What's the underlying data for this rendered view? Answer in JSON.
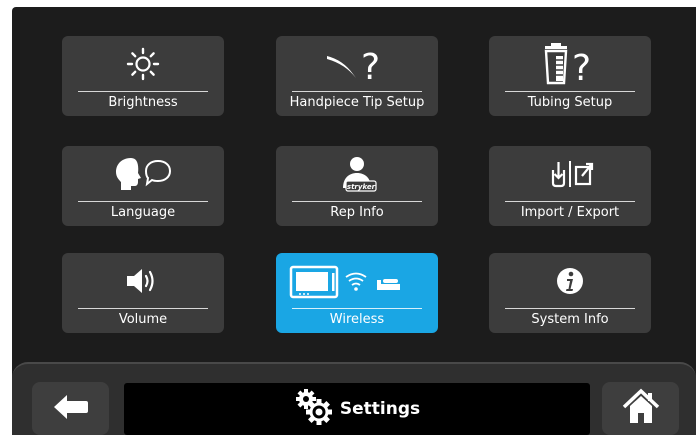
{
  "tiles": [
    {
      "label": "Brightness",
      "icon": "brightness-icon"
    },
    {
      "label": "Handpiece Tip Setup",
      "icon": "handpiece-tip-icon"
    },
    {
      "label": "Tubing Setup",
      "icon": "tubing-icon"
    },
    {
      "label": "Language",
      "icon": "language-icon"
    },
    {
      "label": "Rep Info",
      "icon": "rep-info-icon",
      "badge": "stryker"
    },
    {
      "label": "Import / Export",
      "icon": "import-export-icon"
    },
    {
      "label": "Volume",
      "icon": "volume-icon"
    },
    {
      "label": "Wireless",
      "icon": "wireless-icon",
      "selected": true
    },
    {
      "label": "System Info",
      "icon": "info-icon"
    }
  ],
  "footer": {
    "back_icon": "back-arrow-icon",
    "title": "Settings",
    "title_icon": "gears-icon",
    "home_icon": "home-icon"
  },
  "colors": {
    "background": "#1c1c1c",
    "tile": "#3c3c3c",
    "selected_tile": "#1aa6e4",
    "footer": "#2f2f2f",
    "title_bar": "#000000"
  }
}
